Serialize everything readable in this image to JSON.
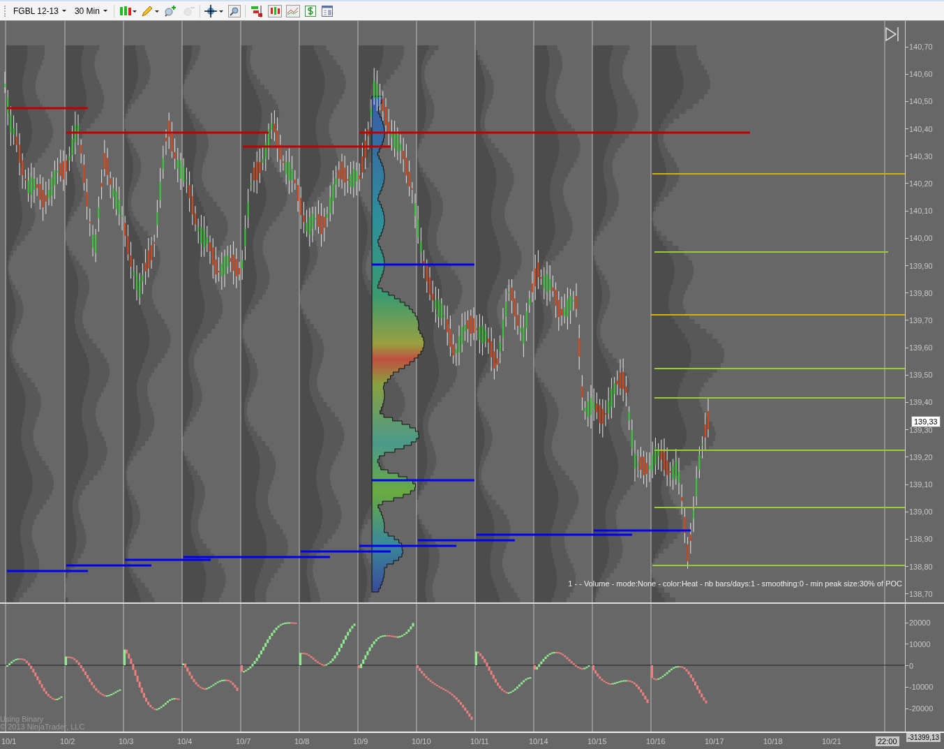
{
  "toolbar": {
    "instrument": "FGBL 12-13",
    "interval": "30 Min"
  },
  "price_axis": {
    "ticks": [
      "140,70",
      "140,60",
      "140,50",
      "140,40",
      "140,30",
      "140,20",
      "140,10",
      "140,00",
      "139,90",
      "139,80",
      "139,70",
      "139,60",
      "139,50",
      "139,40",
      "139,30",
      "139,20",
      "139,10",
      "139,00",
      "138,90",
      "138,80",
      "138,70"
    ],
    "current_price": "139,33"
  },
  "indicator_label": "1 -  - Volume - mode:None - color:Heat - nb bars/days:1 - smoothing:0 - min peak size:30% of POC",
  "indicator_axis": {
    "ticks": [
      "20000",
      "10000",
      "0",
      "-10000",
      "-20000"
    ],
    "current_value": "-31399,13"
  },
  "credits": [
    "Using Binary",
    "© 2013 NinjaTrader, LLC"
  ],
  "date_axis": {
    "labels": [
      "10/1",
      "10/2",
      "10/3",
      "10/4",
      "10/7",
      "10/8",
      "10/9",
      "10/10",
      "10/11",
      "10/14",
      "10/15",
      "10/16",
      "10/17",
      "10/18",
      "10/21"
    ],
    "time_label": "22:00"
  }
}
